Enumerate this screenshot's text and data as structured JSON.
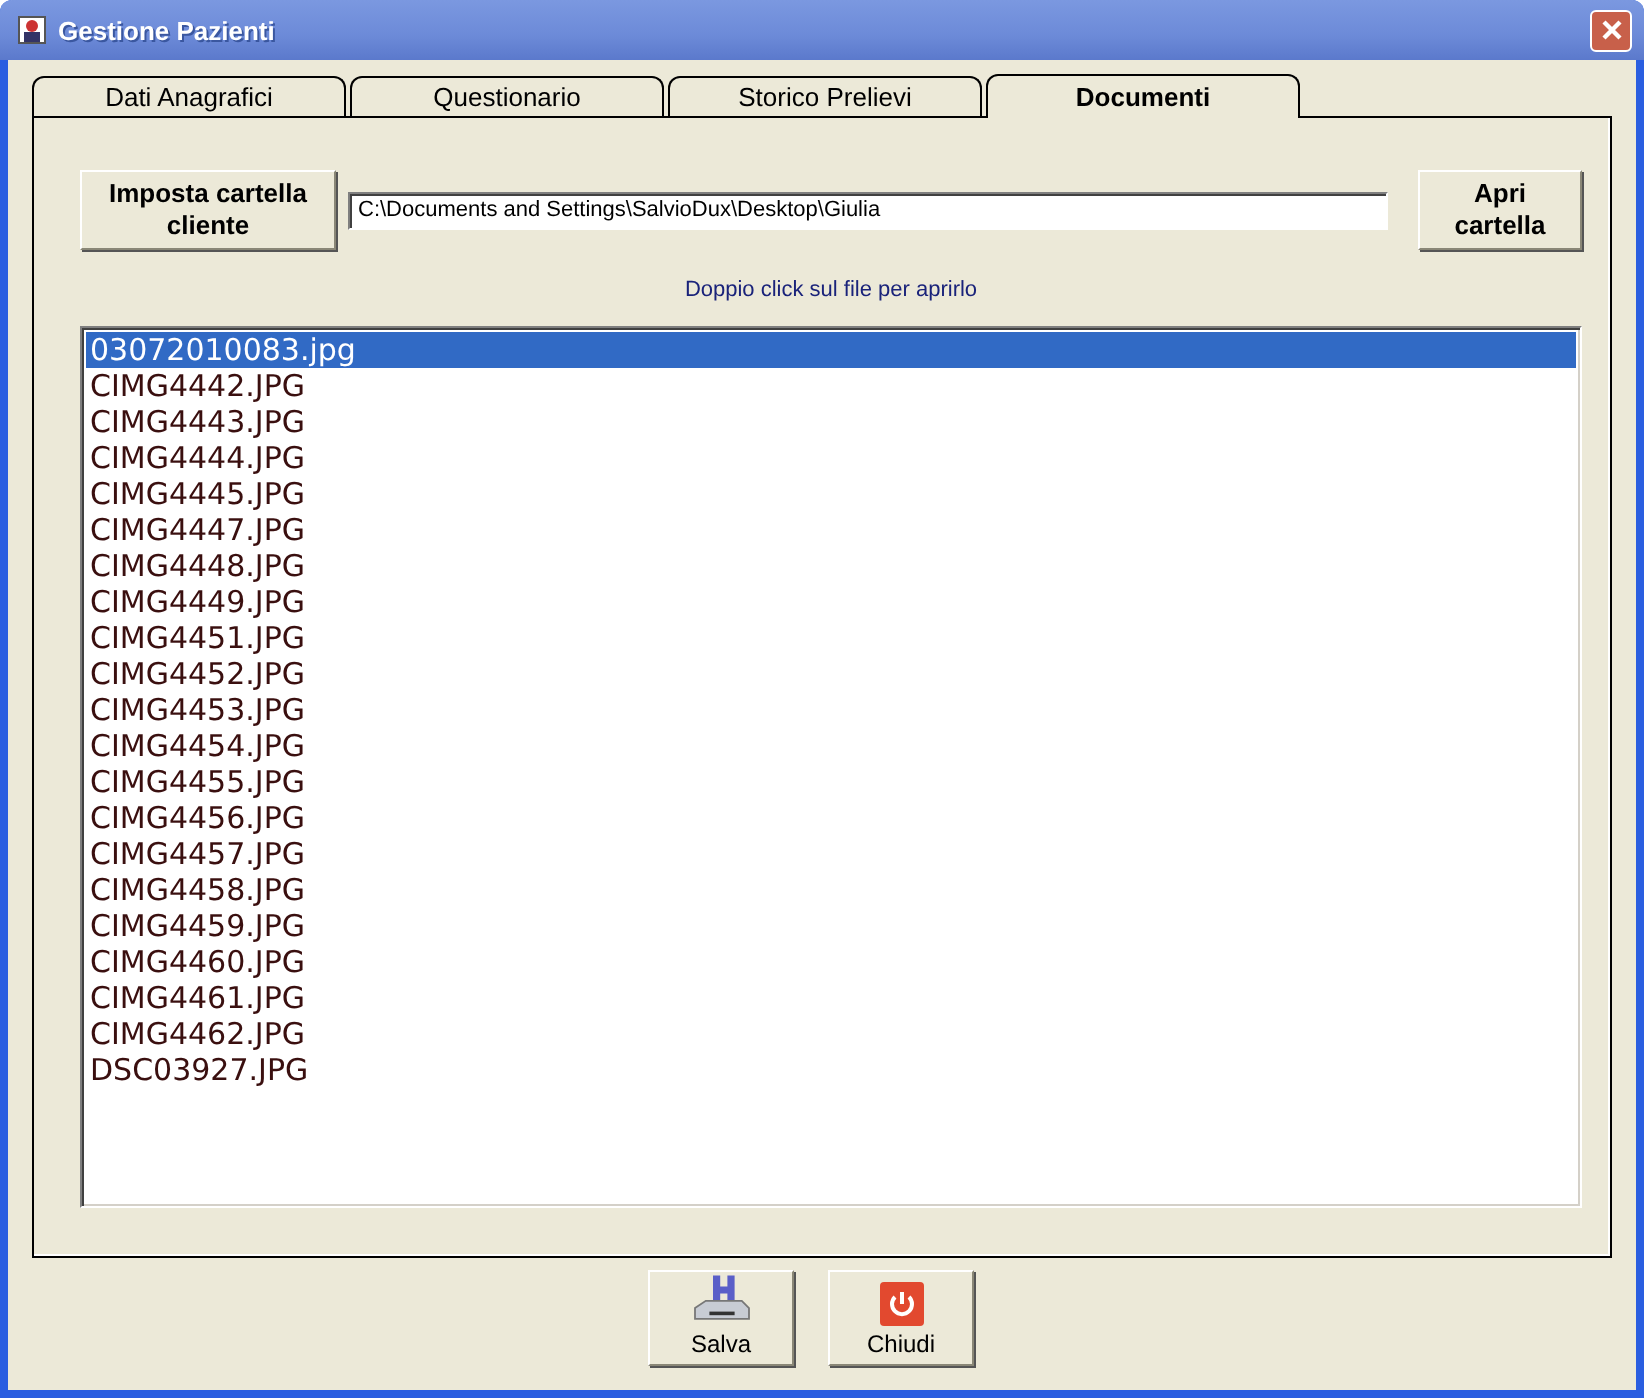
{
  "window": {
    "title": "Gestione Pazienti"
  },
  "tabs": [
    {
      "label": "Dati Anagrafici",
      "selected": false
    },
    {
      "label": "Questionario",
      "selected": false
    },
    {
      "label": "Storico Prelievi",
      "selected": false
    },
    {
      "label": "Documenti",
      "selected": true
    }
  ],
  "folder_button": "Imposta cartella\ncliente",
  "folder_path": {
    "value": "C:\\Documents and Settings\\SalvioDux\\Desktop\\Giulia"
  },
  "open_button": "Apri\ncartella",
  "hint": "Doppio click sul file per aprirlo",
  "files": [
    {
      "name": "03072010083.jpg",
      "selected": true
    },
    {
      "name": "CIMG4442.JPG",
      "selected": false
    },
    {
      "name": "CIMG4443.JPG",
      "selected": false
    },
    {
      "name": "CIMG4444.JPG",
      "selected": false
    },
    {
      "name": "CIMG4445.JPG",
      "selected": false
    },
    {
      "name": "CIMG4447.JPG",
      "selected": false
    },
    {
      "name": "CIMG4448.JPG",
      "selected": false
    },
    {
      "name": "CIMG4449.JPG",
      "selected": false
    },
    {
      "name": "CIMG4451.JPG",
      "selected": false
    },
    {
      "name": "CIMG4452.JPG",
      "selected": false
    },
    {
      "name": "CIMG4453.JPG",
      "selected": false
    },
    {
      "name": "CIMG4454.JPG",
      "selected": false
    },
    {
      "name": "CIMG4455.JPG",
      "selected": false
    },
    {
      "name": "CIMG4456.JPG",
      "selected": false
    },
    {
      "name": "CIMG4457.JPG",
      "selected": false
    },
    {
      "name": "CIMG4458.JPG",
      "selected": false
    },
    {
      "name": "CIMG4459.JPG",
      "selected": false
    },
    {
      "name": "CIMG4460.JPG",
      "selected": false
    },
    {
      "name": "CIMG4461.JPG",
      "selected": false
    },
    {
      "name": "CIMG4462.JPG",
      "selected": false
    },
    {
      "name": "DSC03927.JPG",
      "selected": false
    }
  ],
  "actions": [
    {
      "label": "Salva",
      "kind": "save"
    },
    {
      "label": "Chiudi",
      "kind": "close"
    }
  ]
}
